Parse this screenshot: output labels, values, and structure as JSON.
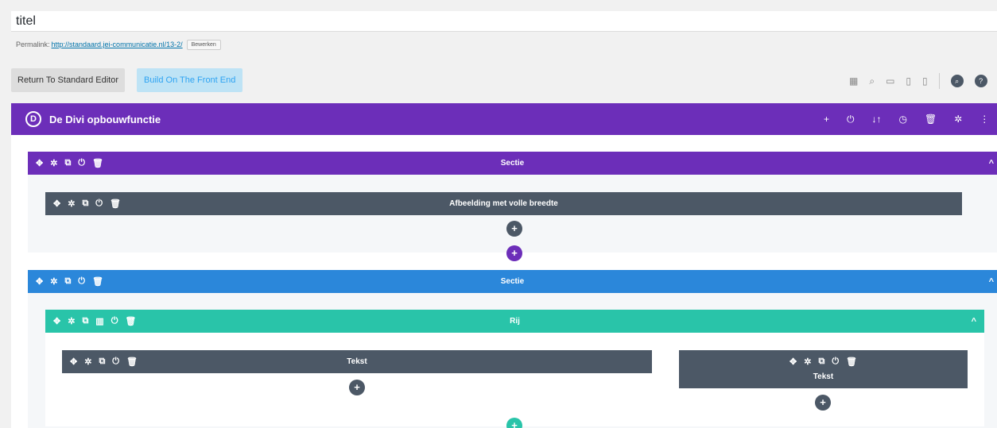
{
  "post": {
    "title": "titel",
    "permalink_label": "Permalink:",
    "permalink_url": "http://standaard.jei-communicatie.nl/13-2/",
    "edit_label": "Bewerken"
  },
  "editor": {
    "return_label": "Return To Standard Editor",
    "front_label": "Build On The Front End"
  },
  "toolbar_icons": [
    "layout-icon",
    "zoom-icon",
    "desktop-icon",
    "tablet-icon",
    "phone-icon",
    "portability-icon",
    "help-icon"
  ],
  "builder": {
    "title": "De Divi opbouwfunctie",
    "logo_letter": "D",
    "header_icons": [
      "add-icon",
      "power-icon",
      "sort-icon",
      "history-icon",
      "trash-icon",
      "gear-icon",
      "more-icon"
    ]
  },
  "sections": [
    {
      "label": "Sectie",
      "color": "#6c2eb9",
      "module": {
        "label": "Afbeelding met volle breedte",
        "color": "#4c5866"
      }
    },
    {
      "label": "Sectie",
      "color": "#2b87da",
      "row": {
        "label": "Rij",
        "color": "#29c4a9",
        "modules": [
          {
            "label": "Tekst",
            "color": "#4c5866"
          },
          {
            "label": "Tekst",
            "color": "#4c5866"
          }
        ]
      }
    }
  ],
  "glyphs": {
    "move": "✥",
    "gear": "✲",
    "dup": "⧉",
    "power": "⏻",
    "trash": "🗑",
    "cols": "▥",
    "plus": "+",
    "chevron": "^",
    "sort": "↓↑",
    "clock": "◷",
    "more": "⋮",
    "layout": "▦",
    "zoom": "⌕",
    "desktop": "▭",
    "tablet": "▯",
    "phone": "▯",
    "help": "?"
  }
}
